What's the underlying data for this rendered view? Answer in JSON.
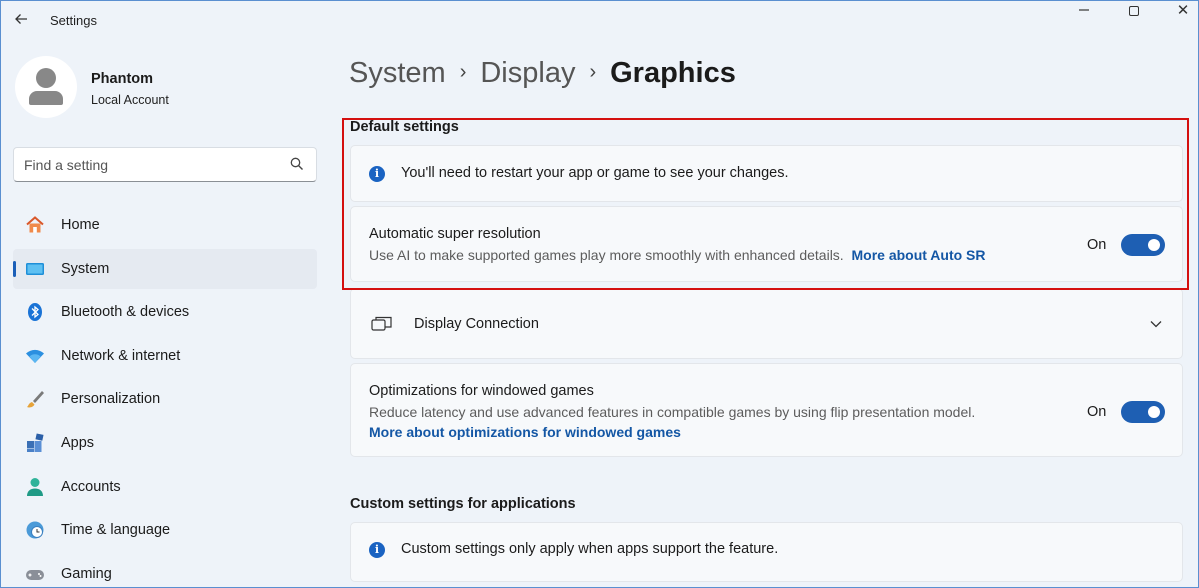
{
  "window": {
    "title": "Settings",
    "controls": {
      "minimize": "—",
      "close": "✕"
    }
  },
  "user": {
    "name": "Phantom",
    "account_type": "Local Account"
  },
  "search": {
    "placeholder": "Find a setting"
  },
  "sidebar": {
    "items": [
      {
        "label": "Home",
        "icon": "home-icon",
        "active": false
      },
      {
        "label": "System",
        "icon": "system-display-icon",
        "active": true
      },
      {
        "label": "Bluetooth & devices",
        "icon": "bluetooth-icon",
        "active": false
      },
      {
        "label": "Network & internet",
        "icon": "wifi-icon",
        "active": false
      },
      {
        "label": "Personalization",
        "icon": "brush-icon",
        "active": false
      },
      {
        "label": "Apps",
        "icon": "apps-icon",
        "active": false
      },
      {
        "label": "Accounts",
        "icon": "accounts-icon",
        "active": false
      },
      {
        "label": "Time & language",
        "icon": "clock-globe-icon",
        "active": false
      },
      {
        "label": "Gaming",
        "icon": "gamepad-icon",
        "active": false
      }
    ]
  },
  "breadcrumb": {
    "items": [
      "System",
      "Display"
    ],
    "separator": "›",
    "current": "Graphics"
  },
  "default_settings": {
    "title": "Default settings",
    "info_text": "You'll need to restart your app or game to see your changes.",
    "auto_sr": {
      "title": "Automatic super resolution",
      "description": "Use AI to make supported games play more smoothly with enhanced details.",
      "link": "More about Auto SR",
      "state_label": "On",
      "enabled": true
    },
    "display_connection": {
      "title": "Display Connection"
    },
    "windowed_games": {
      "title": "Optimizations for windowed games",
      "description": "Reduce latency and use advanced features in compatible games by using flip presentation model.",
      "link": "More about optimizations for windowed games",
      "state_label": "On",
      "enabled": true
    }
  },
  "custom_settings": {
    "title": "Custom settings for applications",
    "info_text": "Custom settings only apply when apps support the feature."
  },
  "colors": {
    "accent": "#1e5fb3",
    "link": "#1457a5",
    "highlight": "#d40f0f",
    "background": "#eef3f9",
    "card": "#f7f9fb"
  }
}
